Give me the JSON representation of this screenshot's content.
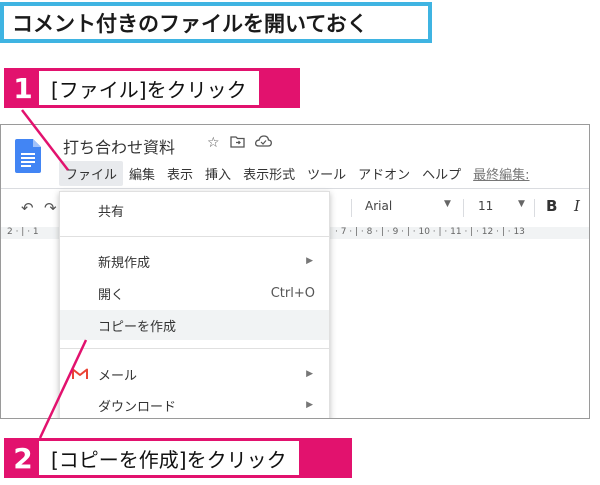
{
  "title": "コメント付きのファイルを開いておく",
  "steps": [
    {
      "num": "1",
      "text": "[ファイル]をクリック"
    },
    {
      "num": "2",
      "text": "[コピーを作成]をクリック"
    }
  ],
  "doc": {
    "title": "打ち合わせ資料",
    "title_icons": [
      "star-icon",
      "folder-move-icon",
      "cloud-status-icon"
    ]
  },
  "menubar": [
    "ファイル",
    "編集",
    "表示",
    "挿入",
    "表示形式",
    "ツール",
    "アドオン",
    "ヘルプ"
  ],
  "last_edit": "最終編集: ",
  "toolbar": {
    "font": "Arial",
    "font_size": "11",
    "bold": "B",
    "italic": "I"
  },
  "ruler": {
    "left": "2 · | · 1",
    "right": "· 7 · | · 8 · | · 9 · | · 10 · | · 11 · | · 12 · | · 13"
  },
  "file_menu": {
    "share": "共有",
    "new": "新規作成",
    "open": "開く",
    "open_shortcut": "Ctrl+O",
    "make_copy": "コピーを作成",
    "email": "メール",
    "download": "ダウンロード"
  },
  "colors": {
    "banner": "#3fb4e2",
    "callout": "#e2126e",
    "doc_icon": "#4285f4",
    "gmail": "#ea4335"
  }
}
